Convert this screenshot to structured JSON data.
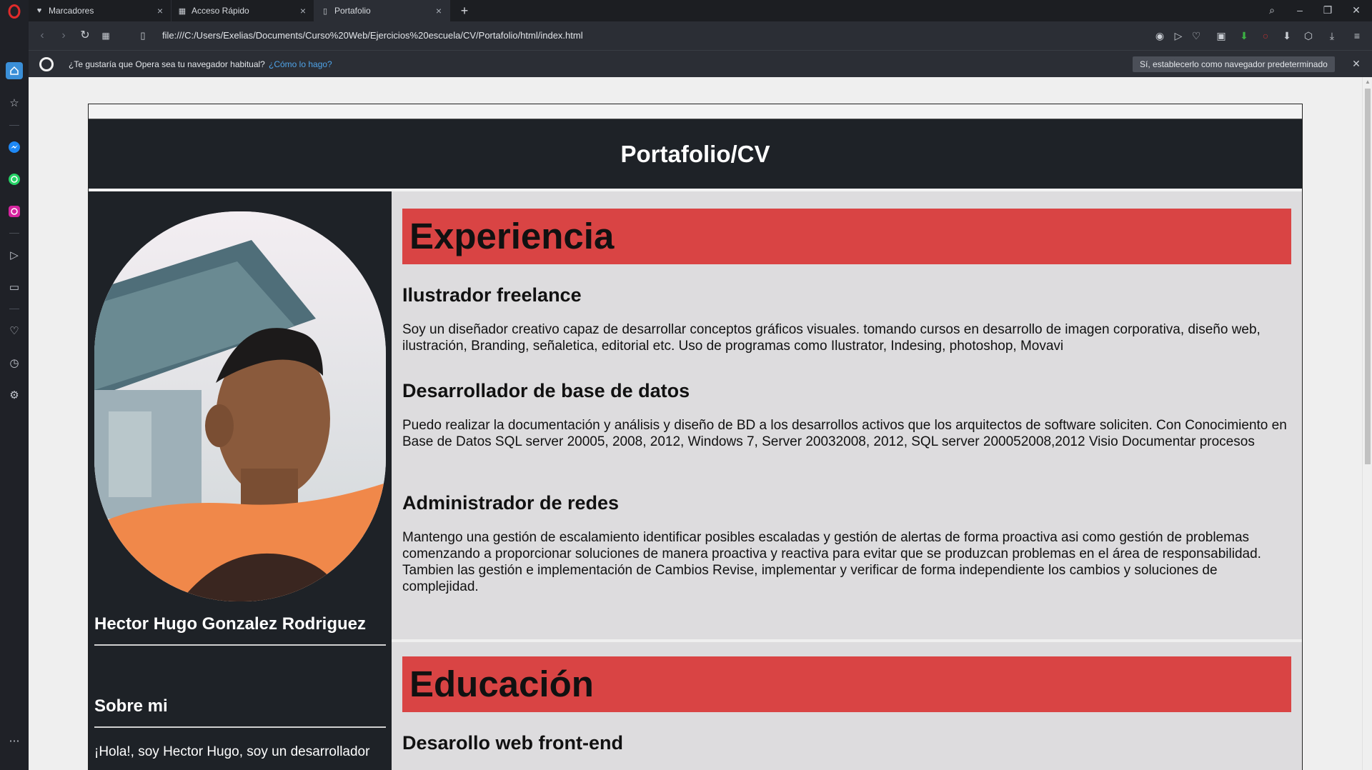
{
  "browser": {
    "tabs": [
      {
        "label": "Marcadores",
        "icon": "heart-icon"
      },
      {
        "label": "Acceso Rápido",
        "icon": "grid-icon"
      },
      {
        "label": "Portafolio",
        "icon": "page-icon"
      }
    ],
    "url": "file:///C:/Users/Exelias/Documents/Curso%20Web/Ejercicios%20escuela/CV/Portafolio/html/index.html",
    "infobar": {
      "text": "¿Te gustaría que Opera sea tu navegador habitual?",
      "link": "¿Cómo lo hago?",
      "button": "Sí, establecerlo como navegador predeterminado"
    }
  },
  "page": {
    "title": "Portafolio/CV",
    "sidebar": {
      "name": "Hector Hugo Gonzalez Rodriguez",
      "about_heading": "Sobre mi",
      "about_text": "¡Hola!, soy Hector Hugo, soy un desarrollador"
    },
    "sections": [
      {
        "heading": "Experiencia",
        "items": [
          {
            "title": "Ilustrador freelance",
            "text": "Soy un diseñador creativo capaz de desarrollar conceptos gráficos visuales. tomando cursos en desarrollo de imagen corporativa, diseño web, ilustración, Branding, señaletica, editorial etc. Uso de programas como Ilustrator, Indesing, photoshop, Movavi"
          },
          {
            "title": "Desarrollador de base de datos",
            "text": "Puedo realizar la documentación y análisis y diseño de BD a los desarrollos activos que los arquitectos de software soliciten. Con Conocimiento en Base de Datos SQL server 20005, 2008, 2012, Windows 7, Server 20032008, 2012, SQL server 200052008,2012 Visio Documentar procesos"
          },
          {
            "title": "Administrador de redes",
            "text": "Mantengo una gestión de escalamiento identificar posibles escaladas y gestión de alertas de forma proactiva asi como gestión de problemas comenzando a proporcionar soluciones de manera proactiva y reactiva para evitar que se produzcan problemas en el área de responsabilidad. Tambien las gestión e implementación de Cambios Revise, implementar y verificar de forma independiente los cambios y soluciones de complejidad."
          }
        ]
      },
      {
        "heading": "Educación",
        "items": [
          {
            "title": "Desarollo web front-end"
          }
        ]
      }
    ]
  },
  "colors": {
    "section_banner": "#d94444",
    "header_bg": "#1e2227",
    "main_bg": "#dddcde"
  }
}
